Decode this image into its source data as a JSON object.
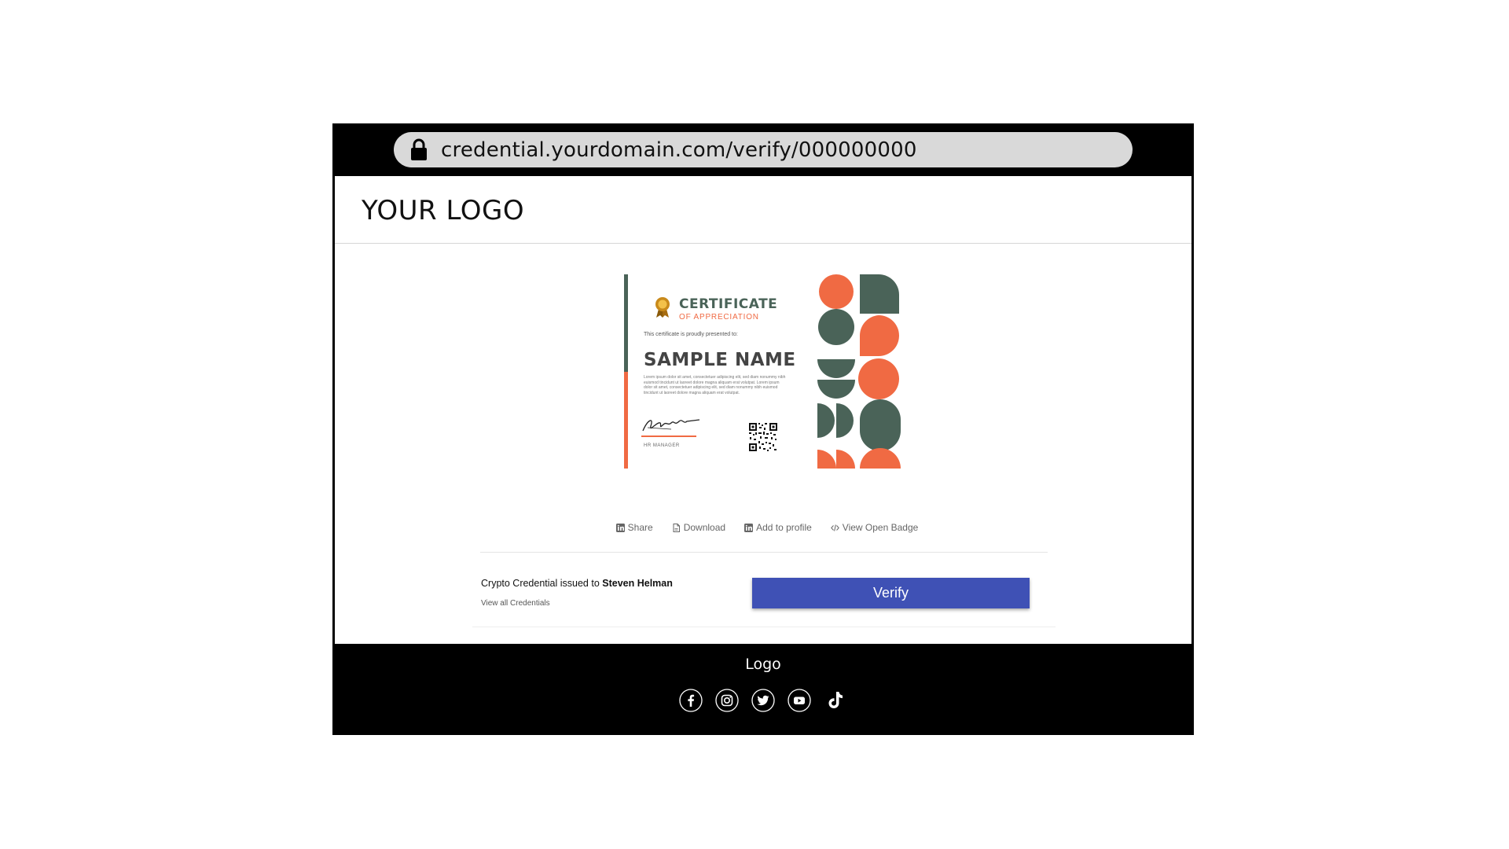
{
  "browser": {
    "url": "credential.yourdomain.com/verify/000000000",
    "lock_icon": "lock-icon"
  },
  "header": {
    "logo_text": "YOUR LOGO"
  },
  "certificate": {
    "title": "CERTIFICATE",
    "subtitle": "OF APPRECIATION",
    "presented_text": "This certificate is proudly presented to:",
    "recipient_name": "SAMPLE NAME",
    "body_text": "Lorem ipsum dolor sit amet, consectetuer adipiscing elit, sed diam nonummy nibh euismod tincidunt ut laoreet dolore magna aliquam erat volutpat. Lorem ipsum dolor sit amet, consectetuer adipiscing elit, sed diam nonummy nibh euismod tincidunt ut laoreet dolore magna aliquam erat volutpat.",
    "signer_role": "HR MANAGER",
    "colors": {
      "green": "#4a6358",
      "orange": "#f06a43"
    }
  },
  "actions": [
    {
      "label": "Share",
      "icon": "linkedin-icon"
    },
    {
      "label": "Download",
      "icon": "document-icon"
    },
    {
      "label": "Add to profile",
      "icon": "linkedin-icon"
    },
    {
      "label": "View Open Badge",
      "icon": "code-icon"
    }
  ],
  "credential": {
    "issued_prefix": "Crypto Credential issued to",
    "recipient": "Steven Helman",
    "view_all": "View all Credentials",
    "verify_label": "Verify",
    "verify_color": "#3f51b5"
  },
  "footer": {
    "logo_text": "Logo",
    "socials": [
      "facebook-icon",
      "instagram-icon",
      "twitter-icon",
      "youtube-icon",
      "tiktok-icon"
    ]
  }
}
